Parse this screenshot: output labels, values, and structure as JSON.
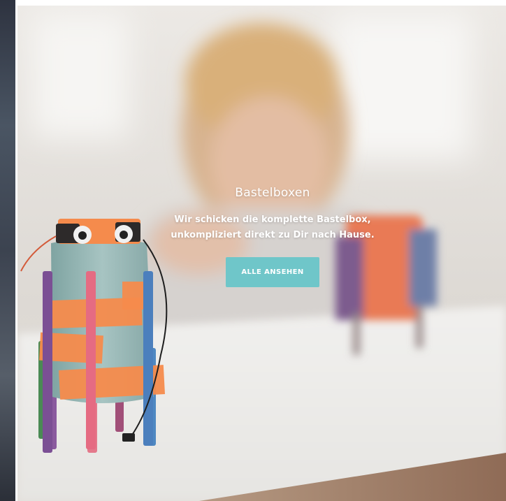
{
  "hero": {
    "title": "Bastelboxen",
    "text": "Wir schicken die komplette Bastelbox, unkompliziert direkt zu Dir nach Hause.",
    "button_label": "ALLE ANSEHEN"
  },
  "colors": {
    "button": "#6fc6c9",
    "text": "#ffffff"
  }
}
